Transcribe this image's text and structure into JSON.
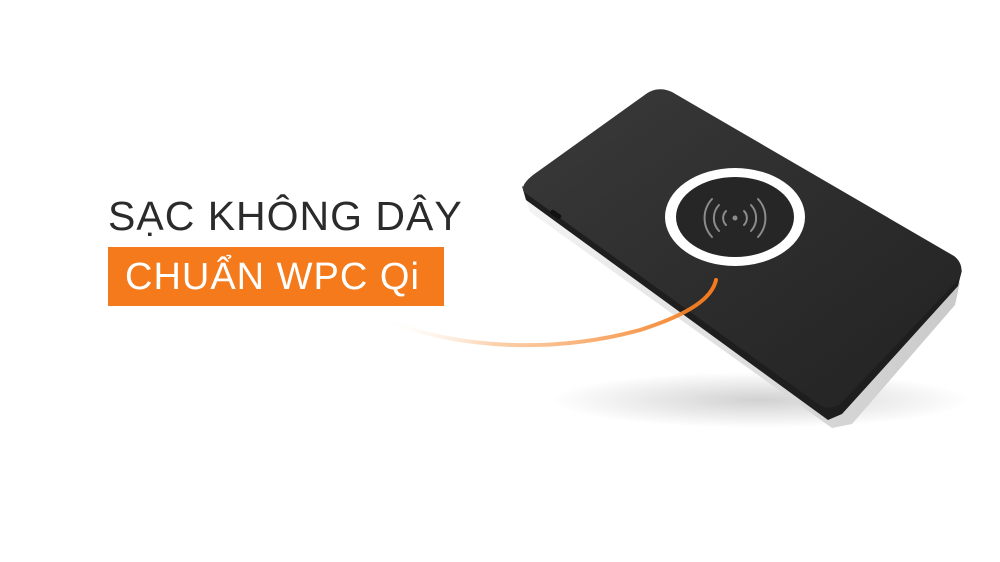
{
  "headline": {
    "line1": "SẠC KHÔNG DÂY",
    "line2": "CHUẨN WPC Qi"
  },
  "colors": {
    "accent": "#f47a1b",
    "text_dark": "#2b2b2b",
    "device_body": "#2d2d2d",
    "device_edge": "#d9d9d9",
    "ring": "#ffffff",
    "background": "#ffffff"
  },
  "icons": {
    "wireless": "wireless-charging-icon"
  }
}
